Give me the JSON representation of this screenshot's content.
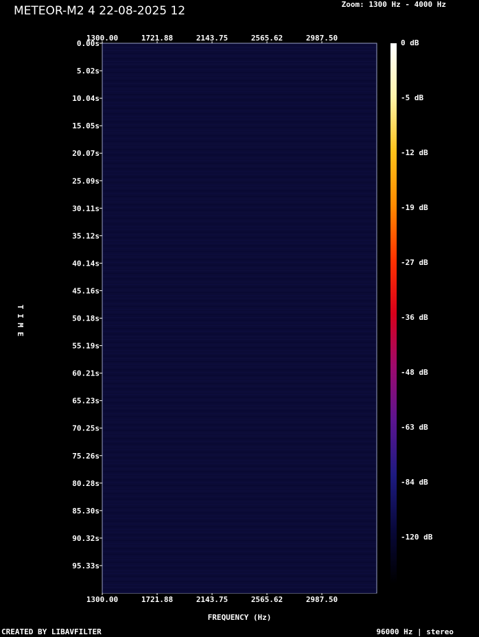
{
  "header": {
    "title": "METEOR-M2 4 22-08-2025 12",
    "zoom": "Zoom: 1300 Hz - 4000 Hz"
  },
  "chart_data": {
    "type": "heatmap",
    "title": "METEOR-M2 4 22-08-2025 12",
    "xlabel": "FREQUENCY (Hz)",
    "ylabel": "TIME",
    "xlim": [
      1300,
      4000
    ],
    "x_ticks": [
      "1300.00",
      "1721.88",
      "2143.75",
      "2565.62",
      "2987.50"
    ],
    "y_ticks": [
      "0.00s",
      "5.02s",
      "10.04s",
      "15.05s",
      "20.07s",
      "25.09s",
      "30.11s",
      "35.12s",
      "40.14s",
      "45.16s",
      "50.18s",
      "55.19s",
      "60.21s",
      "65.23s",
      "70.25s",
      "75.26s",
      "80.28s",
      "85.30s",
      "90.32s",
      "95.33s"
    ],
    "colorbar_ticks": [
      "0 dB",
      "-5 dB",
      "-12 dB",
      "-19 dB",
      "-27 dB",
      "-36 dB",
      "-48 dB",
      "-63 dB",
      "-84 dB",
      "-120 dB"
    ],
    "background_color": "#0b0b36",
    "colormap": [
      "#ffffff",
      "#fff3a8",
      "#ffc21a",
      "#ff8a00",
      "#ff3300",
      "#d8001a",
      "#9c0a6e",
      "#5a1490",
      "#1d1a80",
      "#08083a",
      "#000000"
    ]
  },
  "footer": {
    "left": "CREATED BY LIBAVFILTER",
    "right": "96000 Hz | stereo"
  }
}
